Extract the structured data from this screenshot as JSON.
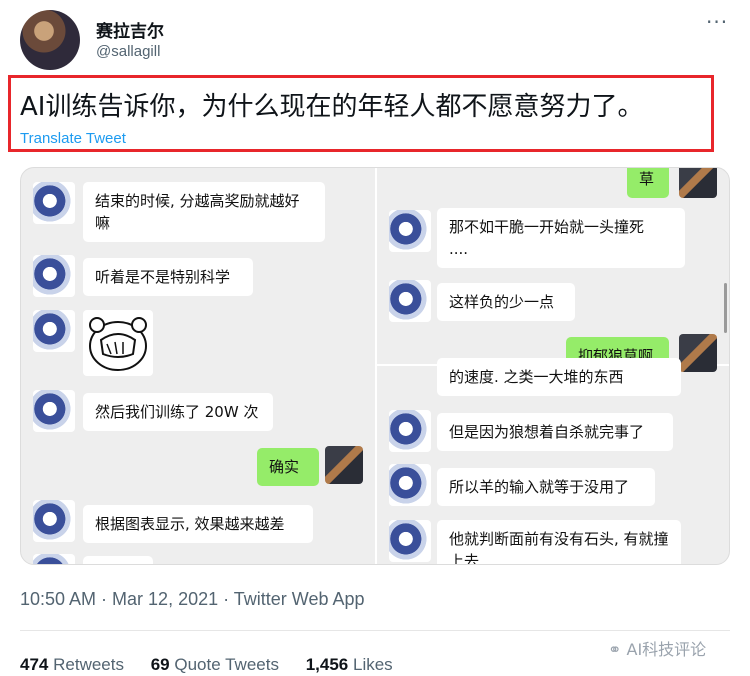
{
  "user": {
    "name": "赛拉吉尔",
    "handle": "@sallagill"
  },
  "tweet": {
    "text": "AI训练告诉你，为什么现在的年轻人都不愿意努力了。",
    "translate_label": "Translate Tweet",
    "more_icon": "more-dots-icon"
  },
  "chat_left": [
    {
      "text": "结束的时候, 分越高奖励就越好嘛"
    },
    {
      "text": "听着是不是特别科学"
    },
    {
      "text": "然后我们训练了 20W 次"
    },
    {
      "text": "确实"
    },
    {
      "text": "根据图表显示, 效果越来越差"
    }
  ],
  "chat_right_top": [
    {
      "text": "草"
    },
    {
      "text": "那不如干脆一开始就一头撞死"
    },
    {
      "text": "...."
    },
    {
      "text": "这样负的少一点"
    },
    {
      "text": "抑郁狼草啊"
    }
  ],
  "chat_right_bottom": [
    {
      "text": "的速度. 之类一大堆的东西"
    },
    {
      "text": "但是因为狼想着自杀就完事了"
    },
    {
      "text": "所以羊的输入就等于没用了"
    },
    {
      "text": "他就判断面前有没有石头, 有就撞上去"
    }
  ],
  "meta": {
    "timestamp": "10:50 AM · Mar 12, 2021 · Twitter Web App",
    "retweets_count": "474",
    "retweets_label": "Retweets",
    "quotes_count": "69",
    "quotes_label": "Quote Tweets",
    "likes_count": "1,456",
    "likes_label": "Likes"
  },
  "watermark": "AI科技评论"
}
